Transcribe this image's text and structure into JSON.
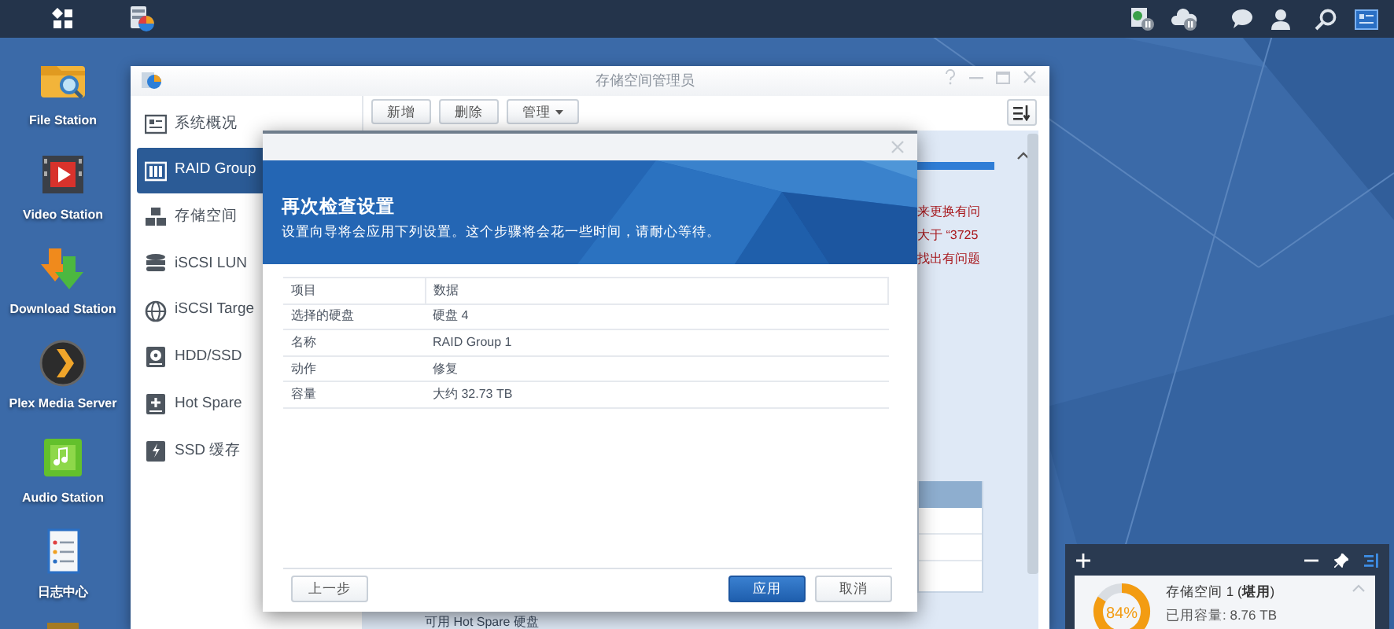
{
  "desktop_icons": [
    {
      "label": "File Station",
      "kind": "folder"
    },
    {
      "label": "Video Station",
      "kind": "video"
    },
    {
      "label": "Download Station",
      "kind": "download"
    },
    {
      "label": "Plex Media Server",
      "kind": "plex"
    },
    {
      "label": "Audio Station",
      "kind": "audio"
    },
    {
      "label": "日志中心",
      "kind": "log"
    },
    {
      "kind": "package"
    }
  ],
  "window": {
    "title": "存储空间管理员",
    "toolbar": [
      {
        "label": "新增",
        "dropdown": false
      },
      {
        "label": "删除",
        "dropdown": false
      },
      {
        "label": "管理",
        "dropdown": true
      }
    ],
    "sidebar": [
      {
        "label": "系统概况",
        "kind": "overview",
        "selected": false
      },
      {
        "label": "RAID Group",
        "kind": "raid",
        "selected": true
      },
      {
        "label": "存储空间",
        "kind": "pool",
        "selected": false
      },
      {
        "label": "iSCSI LUN",
        "kind": "lun",
        "selected": false
      },
      {
        "label": "iSCSI Targe",
        "kind": "target",
        "selected": false
      },
      {
        "label": "HDD/SSD",
        "kind": "disk",
        "selected": false
      },
      {
        "label": "Hot Spare",
        "kind": "spare",
        "selected": false
      },
      {
        "label": "SSD 缓存",
        "kind": "cache",
        "selected": false
      }
    ],
    "warning_lines": [
      "来更换有问",
      "大于 “3725",
      "找出有问题"
    ],
    "footer_text": "可用 Hot Spare 硬盘"
  },
  "dialog": {
    "title": "再次检查设置",
    "subtitle": "设置向导将会应用下列设置。这个步骤将会花一些时间，请耐心等待。",
    "columns": [
      "项目",
      "数据"
    ],
    "rows": [
      [
        "选择的硬盘",
        "硬盘 4"
      ],
      [
        "名称",
        "RAID Group 1"
      ],
      [
        "动作",
        "修复"
      ],
      [
        "容量",
        "大约 32.73 TB"
      ]
    ],
    "buttons": [
      {
        "label": "上一步",
        "kind": "secondary"
      },
      {
        "label": "应用",
        "kind": "primary"
      },
      {
        "label": "取消",
        "kind": "secondary"
      }
    ]
  },
  "widget": {
    "title": "存储空间 1 (**堪用**)",
    "used": "已用容量: 8.76 TB",
    "percent": "84%"
  }
}
